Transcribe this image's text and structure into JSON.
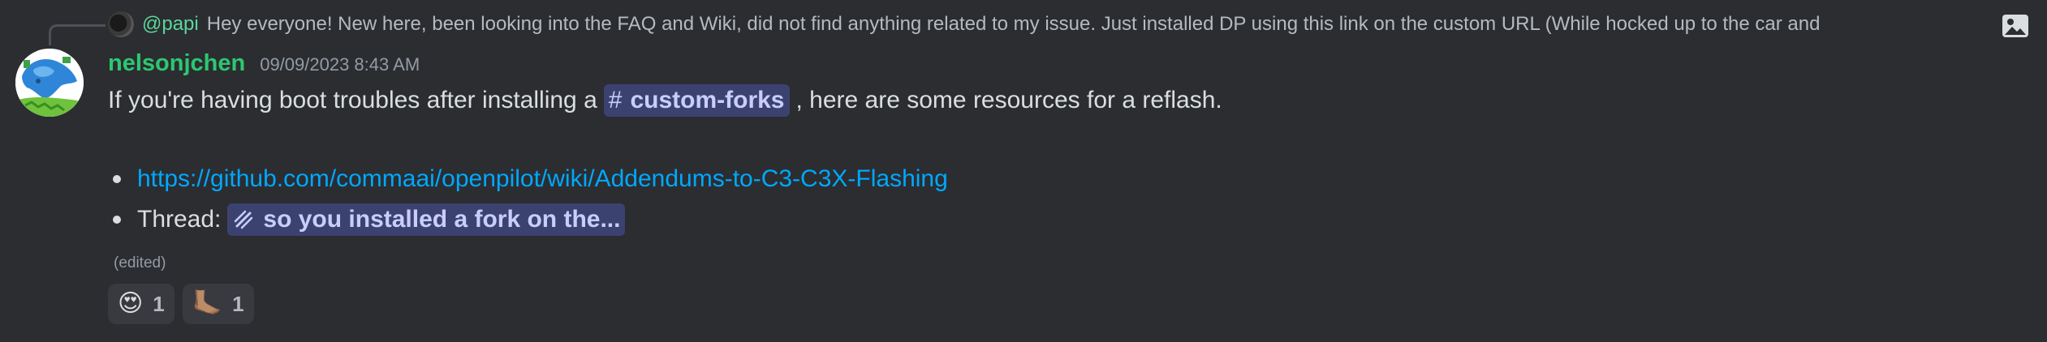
{
  "reply": {
    "author": "@papi",
    "text": "Hey everyone! New here, been looking into the FAQ and Wiki, did not find anything related to my issue. Just installed DP using this link on the custom URL (While hocked up to the car and",
    "attachment_icon": "image-icon"
  },
  "message": {
    "username": "nelsonjchen",
    "timestamp": "09/09/2023 8:43 AM",
    "text_before": "If you're having boot troubles after installing a",
    "channel_mention": {
      "icon": "#",
      "name": "custom-forks"
    },
    "text_after": ", here are some resources for a reflash.",
    "bullets": [
      {
        "link": "https://github.com/commaai/openpilot/wiki/Addendums-to-C3-C3X-Flashing"
      },
      {
        "label": "Thread:",
        "thread_title": "so you installed a fork on the..."
      }
    ],
    "edited": "(edited)"
  },
  "reactions": [
    {
      "emoji": "😍",
      "emoji_name": "heart-eyes-emoji",
      "count": "1"
    },
    {
      "emoji": "🦶🏽",
      "emoji_name": "foot-emoji",
      "count": "1"
    }
  ],
  "colors": {
    "background": "#2b2d31",
    "username": "#2dc770",
    "link": "#00a8fc",
    "mention_bg": "#3c4270",
    "mention_text": "#c9cdfb"
  }
}
